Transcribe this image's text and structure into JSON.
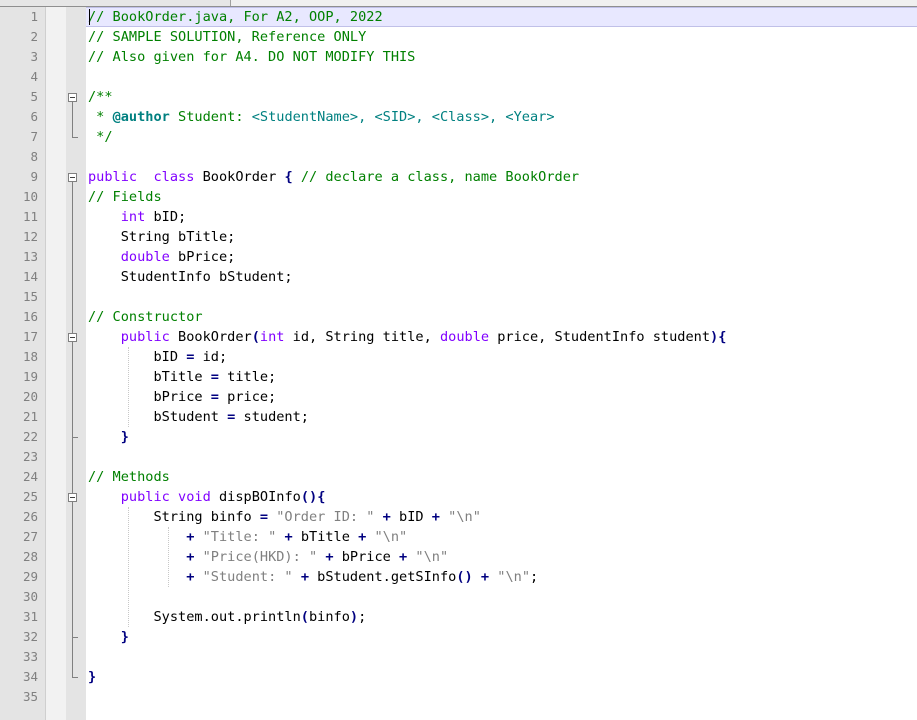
{
  "editor": {
    "lines": [
      {
        "n": "1",
        "segs": [
          [
            "cmt",
            "// BookOrder.java, For A2, OOP, 2022"
          ]
        ]
      },
      {
        "n": "2",
        "segs": [
          [
            "cmt",
            "// SAMPLE SOLUTION, Reference ONLY"
          ]
        ]
      },
      {
        "n": "3",
        "segs": [
          [
            "cmt",
            "// Also given for A4. DO NOT MODIFY THIS"
          ]
        ]
      },
      {
        "n": "4",
        "segs": []
      },
      {
        "n": "5",
        "segs": [
          [
            "cmt",
            "/**"
          ]
        ]
      },
      {
        "n": "6",
        "segs": [
          [
            "cmt",
            " * "
          ],
          [
            "bold",
            "@author"
          ],
          [
            "cmt",
            " Student: "
          ],
          [
            "tag",
            "<StudentName>, <SID>, <Class>, <Year>"
          ]
        ]
      },
      {
        "n": "7",
        "segs": [
          [
            "cmt",
            " */"
          ]
        ]
      },
      {
        "n": "8",
        "segs": []
      },
      {
        "n": "9",
        "segs": [
          [
            "kw",
            "public"
          ],
          [
            "",
            "  "
          ],
          [
            "kw",
            "class"
          ],
          [
            "",
            " BookOrder "
          ],
          [
            "op",
            "{"
          ],
          [
            "",
            " "
          ],
          [
            "cmt",
            "// declare a class, name BookOrder"
          ]
        ]
      },
      {
        "n": "10",
        "segs": [
          [
            "cmt",
            "// Fields"
          ]
        ]
      },
      {
        "n": "11",
        "segs": [
          [
            "",
            "    "
          ],
          [
            "kw",
            "int"
          ],
          [
            "",
            " bID;"
          ]
        ]
      },
      {
        "n": "12",
        "segs": [
          [
            "",
            "    String bTitle;"
          ]
        ]
      },
      {
        "n": "13",
        "segs": [
          [
            "",
            "    "
          ],
          [
            "kw",
            "double"
          ],
          [
            "",
            " bPrice;"
          ]
        ]
      },
      {
        "n": "14",
        "segs": [
          [
            "",
            "    StudentInfo bStudent;"
          ]
        ]
      },
      {
        "n": "15",
        "segs": []
      },
      {
        "n": "16",
        "segs": [
          [
            "cmt",
            "// Constructor"
          ]
        ]
      },
      {
        "n": "17",
        "segs": [
          [
            "",
            "    "
          ],
          [
            "kw",
            "public"
          ],
          [
            "",
            " BookOrder"
          ],
          [
            "op",
            "("
          ],
          [
            "kw",
            "int"
          ],
          [
            "",
            " id, String title, "
          ],
          [
            "kw",
            "double"
          ],
          [
            "",
            " price, StudentInfo student"
          ],
          [
            "op",
            "){"
          ]
        ]
      },
      {
        "n": "18",
        "segs": [
          [
            "",
            "        bID "
          ],
          [
            "op",
            "="
          ],
          [
            "",
            " id;"
          ]
        ]
      },
      {
        "n": "19",
        "segs": [
          [
            "",
            "        bTitle "
          ],
          [
            "op",
            "="
          ],
          [
            "",
            " title;"
          ]
        ]
      },
      {
        "n": "20",
        "segs": [
          [
            "",
            "        bPrice "
          ],
          [
            "op",
            "="
          ],
          [
            "",
            " price;"
          ]
        ]
      },
      {
        "n": "21",
        "segs": [
          [
            "",
            "        bStudent "
          ],
          [
            "op",
            "="
          ],
          [
            "",
            " student;"
          ]
        ]
      },
      {
        "n": "22",
        "segs": [
          [
            "",
            "    "
          ],
          [
            "op",
            "}"
          ]
        ]
      },
      {
        "n": "23",
        "segs": []
      },
      {
        "n": "24",
        "segs": [
          [
            "cmt",
            "// Methods"
          ]
        ]
      },
      {
        "n": "25",
        "segs": [
          [
            "",
            "    "
          ],
          [
            "kw",
            "public"
          ],
          [
            "",
            " "
          ],
          [
            "kw",
            "void"
          ],
          [
            "",
            " dispBOInfo"
          ],
          [
            "op",
            "(){"
          ]
        ]
      },
      {
        "n": "26",
        "segs": [
          [
            "",
            "        String binfo "
          ],
          [
            "op",
            "="
          ],
          [
            "",
            " "
          ],
          [
            "str",
            "\"Order ID: \""
          ],
          [
            "",
            " "
          ],
          [
            "op",
            "+"
          ],
          [
            "",
            " bID "
          ],
          [
            "op",
            "+"
          ],
          [
            "",
            " "
          ],
          [
            "str",
            "\"\\n\""
          ]
        ]
      },
      {
        "n": "27",
        "segs": [
          [
            "",
            "            "
          ],
          [
            "op",
            "+"
          ],
          [
            "",
            " "
          ],
          [
            "str",
            "\"Title: \""
          ],
          [
            "",
            " "
          ],
          [
            "op",
            "+"
          ],
          [
            "",
            " bTitle "
          ],
          [
            "op",
            "+"
          ],
          [
            "",
            " "
          ],
          [
            "str",
            "\"\\n\""
          ]
        ]
      },
      {
        "n": "28",
        "segs": [
          [
            "",
            "            "
          ],
          [
            "op",
            "+"
          ],
          [
            "",
            " "
          ],
          [
            "str",
            "\"Price(HKD): \""
          ],
          [
            "",
            " "
          ],
          [
            "op",
            "+"
          ],
          [
            "",
            " bPrice "
          ],
          [
            "op",
            "+"
          ],
          [
            "",
            " "
          ],
          [
            "str",
            "\"\\n\""
          ]
        ]
      },
      {
        "n": "29",
        "segs": [
          [
            "",
            "            "
          ],
          [
            "op",
            "+"
          ],
          [
            "",
            " "
          ],
          [
            "str",
            "\"Student: \""
          ],
          [
            "",
            " "
          ],
          [
            "op",
            "+"
          ],
          [
            "",
            " bStudent.getSInfo"
          ],
          [
            "op",
            "()"
          ],
          [
            "",
            " "
          ],
          [
            "op",
            "+"
          ],
          [
            "",
            " "
          ],
          [
            "str",
            "\"\\n\""
          ],
          [
            "",
            ";"
          ]
        ]
      },
      {
        "n": "30",
        "segs": []
      },
      {
        "n": "31",
        "segs": [
          [
            "",
            "        System.out.println"
          ],
          [
            "op",
            "("
          ],
          [
            "",
            "binfo"
          ],
          [
            "op",
            ")"
          ],
          [
            "",
            ";"
          ]
        ]
      },
      {
        "n": "32",
        "segs": [
          [
            "",
            "    "
          ],
          [
            "op",
            "}"
          ]
        ]
      },
      {
        "n": "33",
        "segs": []
      },
      {
        "n": "34",
        "segs": [
          [
            "op",
            "}"
          ]
        ]
      },
      {
        "n": "35",
        "segs": []
      }
    ]
  }
}
